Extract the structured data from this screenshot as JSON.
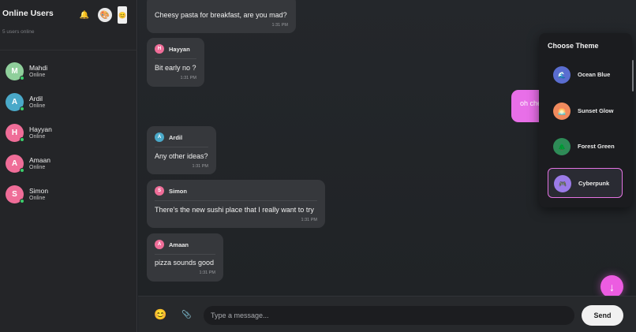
{
  "sidebar": {
    "title": "Online Users",
    "subtitle": "5 users online",
    "icons": [
      "bell-icon",
      "palette-icon",
      "emoji-icon"
    ],
    "users": [
      {
        "initial": "M",
        "name": "Mahdi",
        "status": "Online",
        "color": "#8fcf9b"
      },
      {
        "initial": "A",
        "name": "Ardil",
        "status": "Online",
        "color": "#4aa9c9"
      },
      {
        "initial": "H",
        "name": "Hayyan",
        "status": "Online",
        "color": "#ef6d98"
      },
      {
        "initial": "A",
        "name": "Amaan",
        "status": "Online",
        "color": "#ef6d98"
      },
      {
        "initial": "S",
        "name": "Simon",
        "status": "Online",
        "color": "#ef6d98"
      }
    ]
  },
  "messages": [
    {
      "sender": "",
      "initial": "",
      "text": "Cheesy pasta for breakfast, are you mad?",
      "time": "1:31 PM"
    },
    {
      "sender": "Hayyan",
      "initial": "H",
      "color": "#ef6d98",
      "text": "Bit early no ?",
      "time": "1:31 PM"
    },
    {
      "sender": "Ardil",
      "initial": "A",
      "color": "#4aa9c9",
      "text": "Any other ideas?",
      "time": "1:31 PM"
    },
    {
      "sender": "Simon",
      "initial": "S",
      "color": "#ef6d98",
      "text": "There's the new sushi place that I really want to try",
      "time": "1:31 PM"
    },
    {
      "sender": "Amaan",
      "initial": "A",
      "color": "#ef6d98",
      "text": "pizza sounds good",
      "time": "1:31 PM"
    }
  ],
  "own_message": {
    "text": "oh che"
  },
  "input": {
    "placeholder": "Type a message...",
    "send_label": "Send"
  },
  "theme_panel": {
    "title": "Choose Theme",
    "themes": [
      {
        "label": "Ocean Blue",
        "icon": "wave-icon",
        "color": "#5a6dd0",
        "selected": false
      },
      {
        "label": "Sunset Glow",
        "icon": "sunset-icon",
        "color": "#f08a5d",
        "selected": false
      },
      {
        "label": "Forest Green",
        "icon": "tree-icon",
        "color": "#2e8b57",
        "selected": false
      },
      {
        "label": "Cyberpunk",
        "icon": "gamepad-icon",
        "color": "#9b7be8",
        "selected": true
      }
    ]
  },
  "colors": {
    "accent": "#ec5ce1",
    "background": "#1f2125",
    "online": "#3ccf6c"
  }
}
